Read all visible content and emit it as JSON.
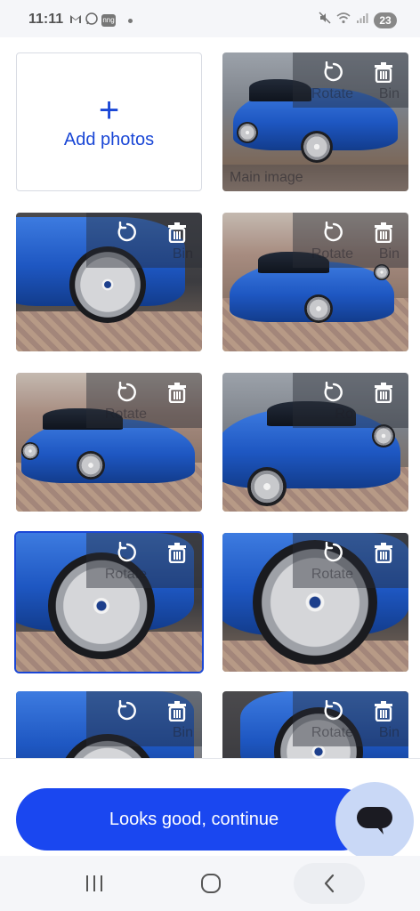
{
  "status_bar": {
    "time": "11:11",
    "notification_icons": [
      "gmail-icon",
      "whatsapp-icon",
      "app-icon"
    ],
    "app_icon_text": "nng",
    "battery_level": "23",
    "right_icons": [
      "mute-icon",
      "wifi-icon",
      "signal-icon"
    ]
  },
  "gallery": {
    "add_tile": {
      "plus_glyph": "+",
      "label": "Add photos"
    },
    "tiles": [
      {
        "rotate_text": "Rotate",
        "bin_text": "Bin",
        "main_label": "Main image"
      },
      {
        "rotate_text": "",
        "bin_text": "Bin",
        "main_label": ""
      },
      {
        "rotate_text": "Rotate",
        "bin_text": "Bin",
        "main_label": ""
      },
      {
        "rotate_text": "Rotate",
        "bin_text": "",
        "main_label": ""
      },
      {
        "rotate_text": "Ro",
        "bin_text": "",
        "main_label": ""
      },
      {
        "rotate_text": "Rotate",
        "bin_text": "",
        "main_label": ""
      },
      {
        "rotate_text": "Rotate",
        "bin_text": "",
        "main_label": ""
      },
      {
        "rotate_text": "",
        "bin_text": "Bin",
        "main_label": ""
      },
      {
        "rotate_text": "Rotate",
        "bin_text": "Bin",
        "main_label": ""
      }
    ]
  },
  "footer": {
    "continue_label": "Looks good, continue",
    "chat_icon": "chat-bubble-icon"
  },
  "nav_bar": {
    "recent_icon": "recent-apps-icon",
    "home_icon": "home-icon",
    "back_icon": "back-icon"
  },
  "colors": {
    "accent": "#1a47f0",
    "add_text": "#1a47d6",
    "chat_fab": "#c9d8f6"
  }
}
